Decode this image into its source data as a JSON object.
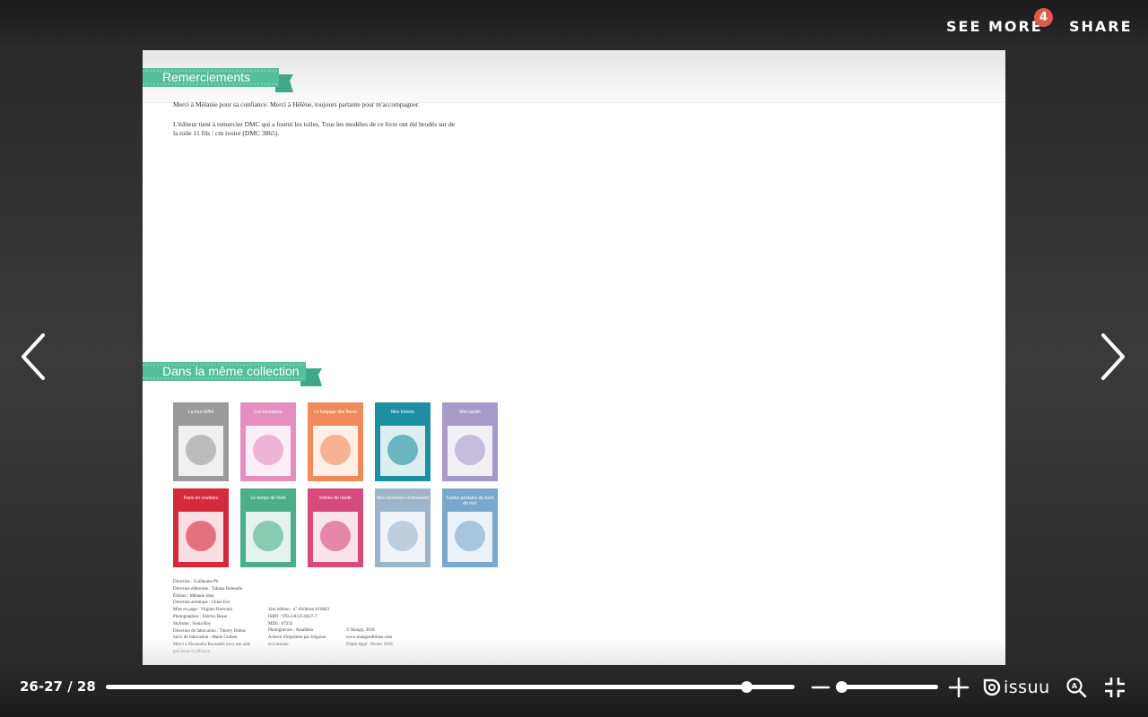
{
  "topbar": {
    "see_more_label": "SEE MORE",
    "see_more_badge": "4",
    "share_label": "SHARE"
  },
  "document": {
    "section1_title": "Remerciements",
    "para1": "Merci à Mélanie pour sa confiance. Merci à Hélène, toujours partante pour m'accompagner.",
    "para2": "L'éditeur tient à remercier DMC qui a fourni les toiles. Tous les modèles de ce livre ont été brodés sur de la toile 11 fils / cm ivoire (DMC 3865).",
    "section2_title": "Dans la même collection",
    "covers": [
      {
        "title": "La tour Eiffel",
        "color": "#9a9a9a"
      },
      {
        "title": "Les boutiques",
        "color": "#e58fbf"
      },
      {
        "title": "Le langage des fleurs",
        "color": "#f08a5a"
      },
      {
        "title": "Mes trésors",
        "color": "#1e8fa0"
      },
      {
        "title": "Mon jardin",
        "color": "#a89ac8"
      },
      {
        "title": "Paris en couleurs",
        "color": "#d62a3c"
      },
      {
        "title": "Le temps de Noël",
        "color": "#4bb08a"
      },
      {
        "title": "Icônes de mode",
        "color": "#d64a7c"
      },
      {
        "title": "Mes broderies d'ornement",
        "color": "#9cb4cc"
      },
      {
        "title": "Cartes postales du bord de mer",
        "color": "#7aa8cc"
      }
    ],
    "credits_col1": "Direction : Guillaume Pô\nDirection éditoriale : Tatiana Delesalle\nÉdition : Mélanie Jean\nDirection artistique : Chloé Eve\nMise en page : Virginie Harrouin\nPhotographies : Fabrice Besse\nStylisme : Sonia Roy\nDirection de fabrication : Thierry Dubus\nSuivi de fabrication : Marie Guillen\nMerci à Alexandra Rousselle pour son aide\nprécieuse et efficace.",
    "credits_col2": "1ère édition - n° d'édition A16663\nISBN : 978-2-8125-0637-7\nMDS : 67332\nPhotogravure : Amalthéa\nAchevé d'imprimer par Jelgavas\nen Lettonie",
    "credits_col3": "© Mango, 2018\nwww.mangoeditions.com\nDépôt légal : février 2018"
  },
  "controls": {
    "page_counter": "26-27 / 28",
    "progress_fraction": 0.93,
    "zoom_fraction": 0.04,
    "brand": "issuu"
  }
}
